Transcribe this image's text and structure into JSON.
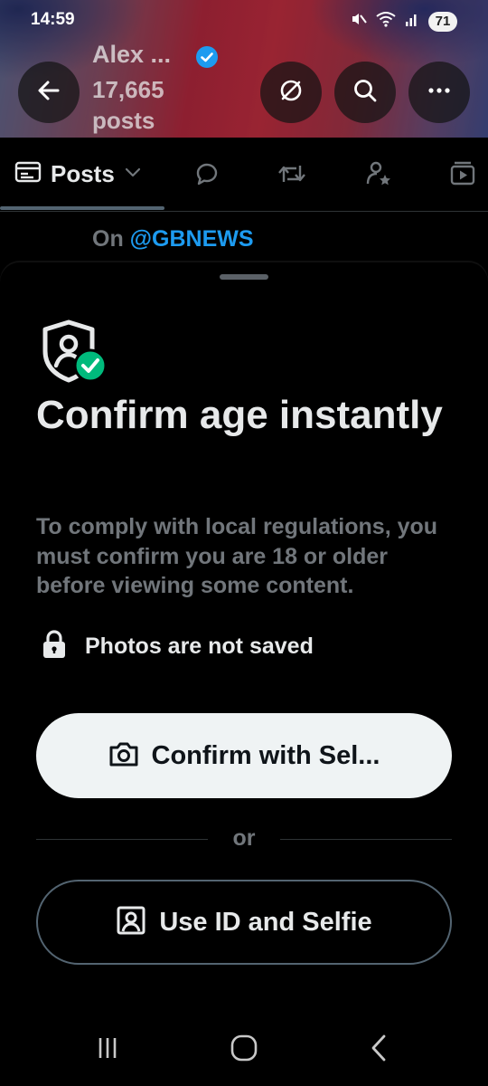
{
  "status_bar": {
    "time": "14:59",
    "battery": "71",
    "icons": [
      "mute-icon",
      "wifi-icon",
      "signal-icon",
      "battery-icon"
    ]
  },
  "profile_header": {
    "name": "Alex ...",
    "post_count": "17,665",
    "post_count_unit": "posts",
    "verified": true,
    "buttons": [
      "back-arrow-icon",
      "edit-off-icon",
      "search-icon",
      "more-icon"
    ]
  },
  "tabs": {
    "active_label": "Posts",
    "icons": [
      "posts-icon",
      "replies-icon",
      "reposts-icon",
      "highlights-icon",
      "media-icon"
    ]
  },
  "context": {
    "prefix": "On",
    "handle": "@GBNEWS"
  },
  "sheet": {
    "title": "Confirm age instantly",
    "description": "To comply with local regulations, you must confirm you are 18 or older before viewing some content.",
    "privacy_note": "Photos are not saved",
    "primary_button": "Confirm with Sel...",
    "divider_text": "or",
    "secondary_button": "Use ID and Selfie"
  },
  "colors": {
    "background": "#000000",
    "primary_text": "#e7e9ea",
    "secondary_text": "#71767b",
    "accent": "#1d9bf0",
    "success": "#00ba7c",
    "primary_button_bg": "#eff3f4"
  }
}
